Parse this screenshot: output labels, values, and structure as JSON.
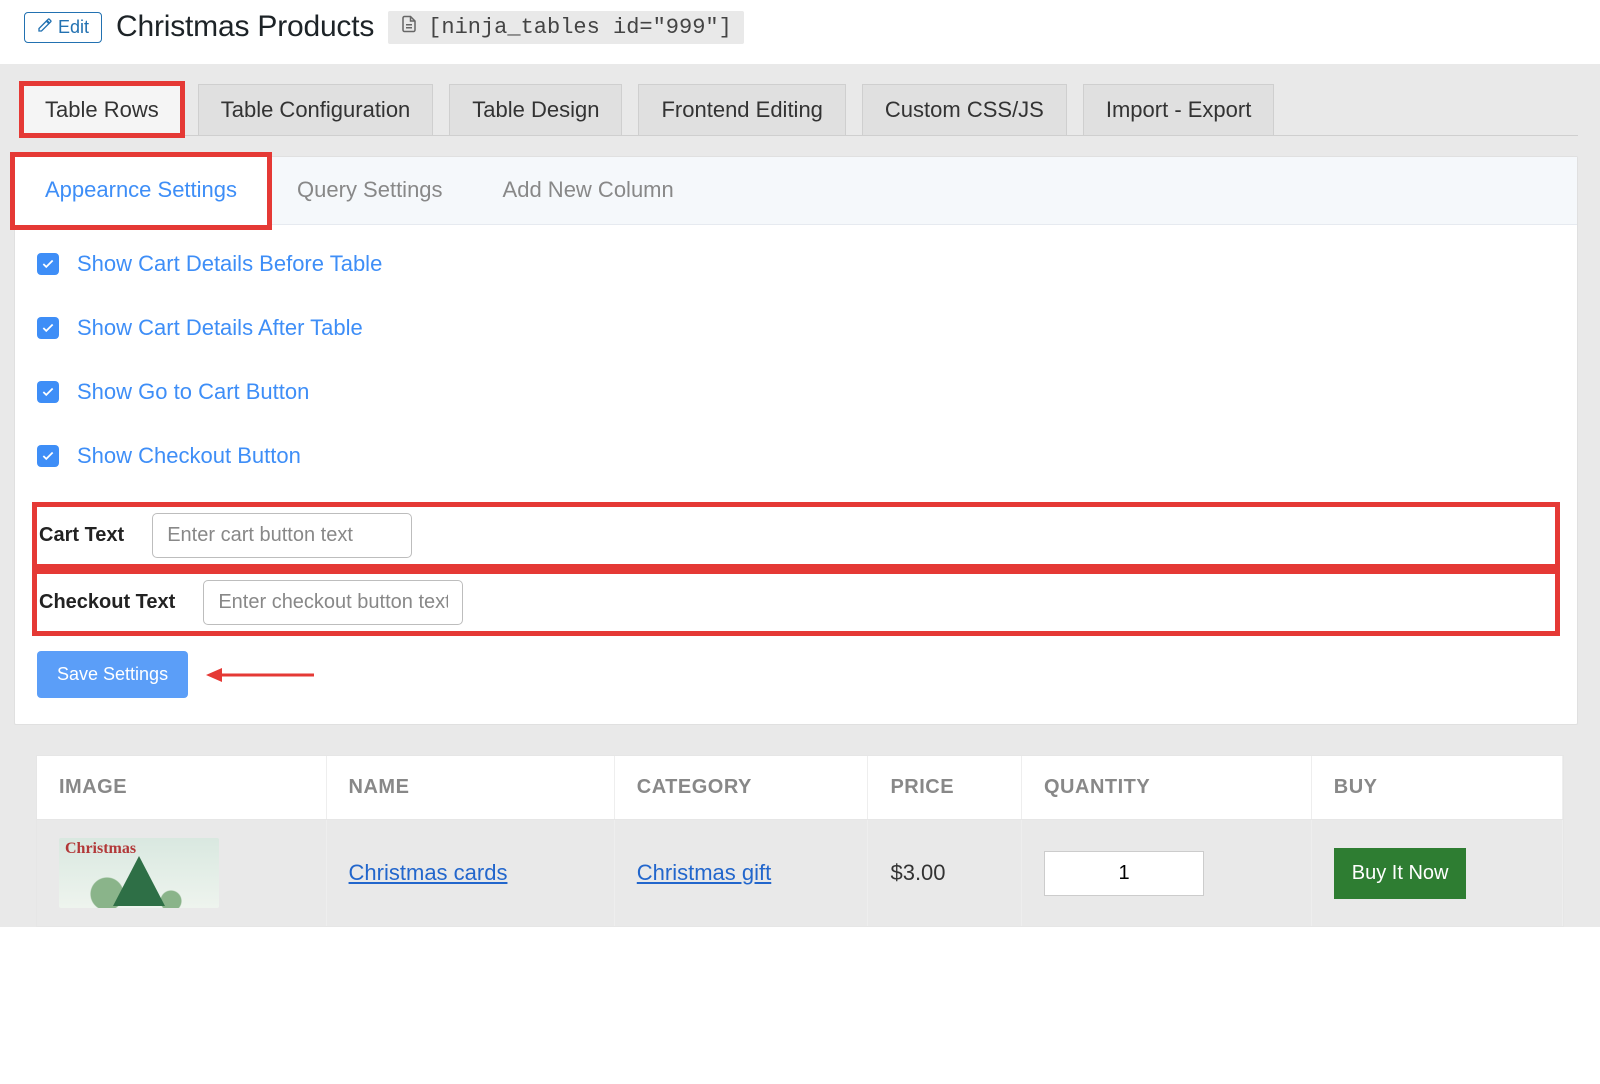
{
  "header": {
    "edit_label": "Edit",
    "title": "Christmas Products",
    "shortcode": "[ninja_tables id=\"999\"]"
  },
  "main_tabs": [
    "Table Rows",
    "Table Configuration",
    "Table Design",
    "Frontend Editing",
    "Custom CSS/JS",
    "Import - Export"
  ],
  "sub_tabs": [
    "Appearnce Settings",
    "Query Settings",
    "Add New Column"
  ],
  "settings": {
    "checks": [
      "Show Cart Details Before Table",
      "Show Cart Details After Table",
      "Show Go to Cart Button",
      "Show Checkout Button"
    ],
    "cart_text_label": "Cart Text",
    "cart_text_placeholder": "Enter cart button text",
    "checkout_text_label": "Checkout Text",
    "checkout_text_placeholder": "Enter checkout button text",
    "save_label": "Save Settings"
  },
  "table": {
    "headers": [
      "IMAGE",
      "NAME",
      "CATEGORY",
      "PRICE",
      "QUANTITY",
      "BUY"
    ],
    "row": {
      "name": "Christmas cards",
      "category": "Christmas gift",
      "price": "$3.00",
      "quantity": "1",
      "buy_label": "Buy It Now",
      "thumb_script": "Christmas"
    }
  }
}
